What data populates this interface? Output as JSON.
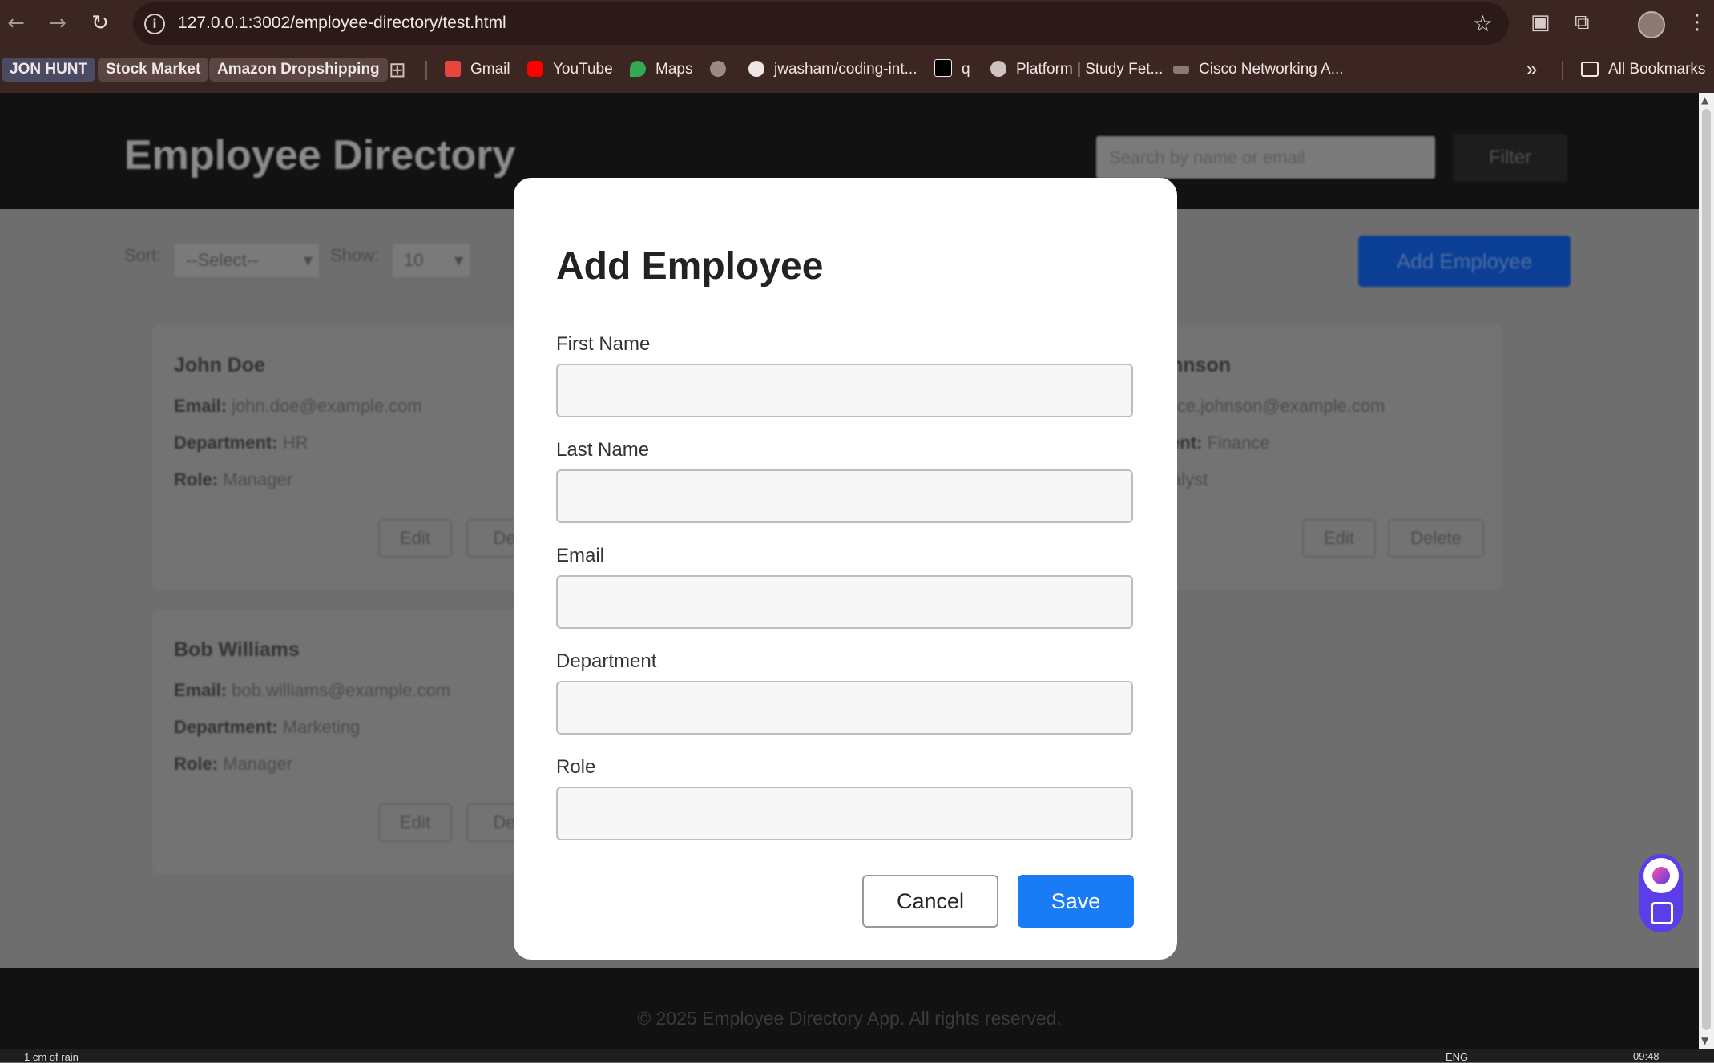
{
  "browser": {
    "url": "127.0.0.1:3002/employee-directory/test.html",
    "bookmarks": [
      {
        "label": "JON HUNT"
      },
      {
        "label": "Stock Market"
      },
      {
        "label": "Amazon Dropshipping"
      },
      {
        "label": "Gmail"
      },
      {
        "label": "YouTube"
      },
      {
        "label": "Maps"
      },
      {
        "label": "jwasham/coding-int..."
      },
      {
        "label": "q"
      },
      {
        "label": "Platform | Study Fet..."
      },
      {
        "label": "Cisco Networking A..."
      }
    ],
    "all_bookmarks": "All Bookmarks",
    "overflow": "»"
  },
  "page": {
    "title": "Employee Directory",
    "search_placeholder": "Search by name or email",
    "filter_label": "Filter",
    "sort_label": "Sort:",
    "sort_value": "--Select--",
    "show_label": "Show:",
    "show_value": "10",
    "add_button": "Add Employee",
    "cards": [
      {
        "name": "John Doe",
        "email": "john.doe@example.com",
        "department": "HR",
        "role": "Manager"
      },
      {
        "name": "hnson",
        "email": "ice.johnson@example.com",
        "department": "Finance",
        "role": "alyst"
      },
      {
        "name": "Bob Williams",
        "email": "bob.williams@example.com",
        "department": "Marketing",
        "role": "Manager"
      }
    ],
    "email_label": "Email:",
    "department_label": "Department:",
    "department_label_cut": "ent:",
    "role_label": "Role:",
    "edit_label": "Edit",
    "delete_label": "Delete",
    "delete_label_cut": "Del",
    "footer": "© 2025 Employee Directory App. All rights reserved."
  },
  "modal": {
    "title": "Add Employee",
    "fields": [
      {
        "label": "First Name",
        "value": ""
      },
      {
        "label": "Last Name",
        "value": ""
      },
      {
        "label": "Email",
        "value": ""
      },
      {
        "label": "Department",
        "value": ""
      },
      {
        "label": "Role",
        "value": ""
      }
    ],
    "cancel_label": "Cancel",
    "save_label": "Save"
  },
  "taskbar": {
    "weather": "1 cm of rain",
    "language": "ENG",
    "time": "09:48"
  },
  "colors": {
    "accent": "#1a7cf5",
    "chrome": "#3c2622"
  }
}
